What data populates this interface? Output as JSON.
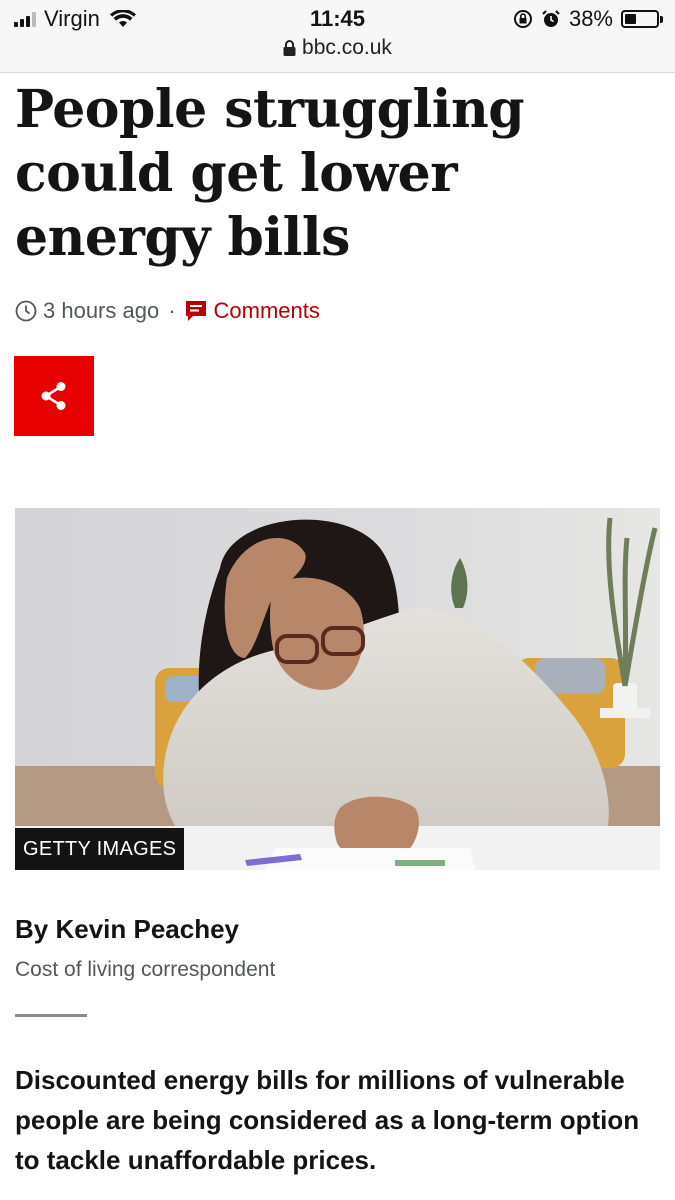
{
  "status_bar": {
    "carrier": "Virgin",
    "time": "11:45",
    "battery": "38%",
    "battery_level": 0.38,
    "url": "bbc.co.uk",
    "icons": [
      "signal-icon",
      "wifi-icon",
      "orientation-lock-icon",
      "alarm-icon",
      "battery-icon",
      "lock-icon"
    ]
  },
  "article": {
    "headline": "People struggling could get lower energy bills",
    "timestamp": "3 hours ago",
    "separator": "·",
    "comments_label": "Comments",
    "share_icon": "share-icon",
    "image_credit": "GETTY IMAGES",
    "author": "By Kevin Peachey",
    "author_role": "Cost of living correspondent",
    "intro": "Discounted energy bills for millions of vulnerable people are being considered as a long-term option to tackle unaffordable prices."
  },
  "colors": {
    "share_red": "#e60000",
    "comments_red": "#b80000",
    "text": "#141414",
    "meta_grey": "#545658"
  }
}
